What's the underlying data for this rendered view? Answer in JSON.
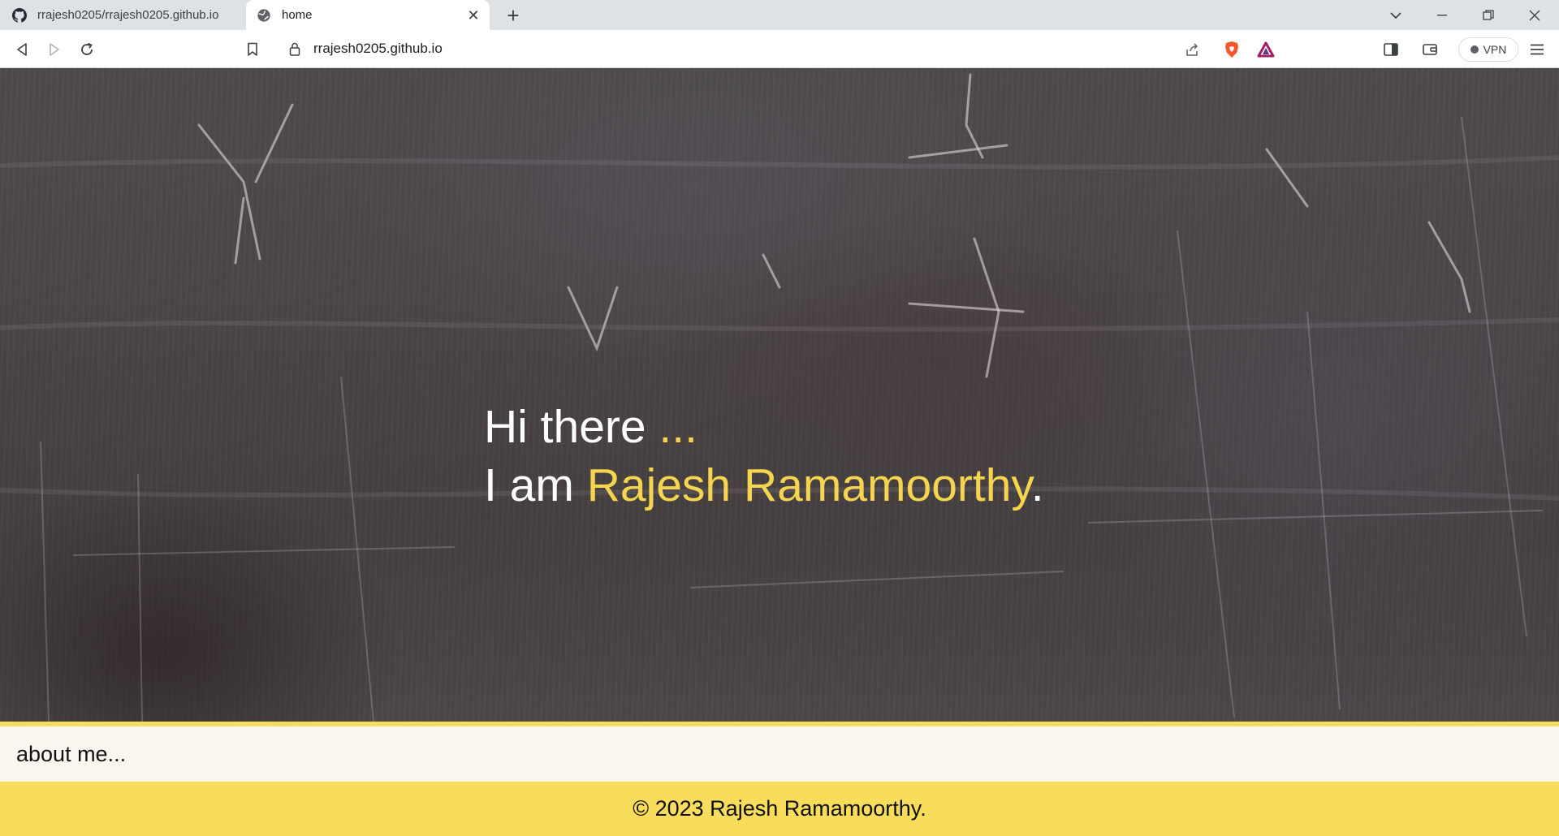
{
  "browser": {
    "tabs": [
      {
        "title": "rrajesh0205/rrajesh0205.github.io",
        "icon": "github-icon",
        "active": false
      },
      {
        "title": "home",
        "icon": "globe-icon",
        "active": true
      }
    ],
    "address_bar": {
      "url": "rrajesh0205.github.io"
    },
    "vpn_label": "VPN",
    "colors": {
      "tabstrip": "#dee1e6",
      "toolbar": "#ffffff"
    }
  },
  "hero": {
    "greeting": "Hi there ",
    "greeting_dots": "...",
    "intro_prefix": "I am ",
    "name": "Rajesh Ramamoorthy",
    "intro_suffix": "."
  },
  "about": {
    "link_label": "about me..."
  },
  "footer": {
    "copyright": "© 2023 Rajesh Ramamoorthy."
  },
  "colors": {
    "accent": "#f5d54f",
    "footer_bg": "#f8dc5c",
    "about_bg": "#faf7f0",
    "hero_text": "#ffffff"
  }
}
